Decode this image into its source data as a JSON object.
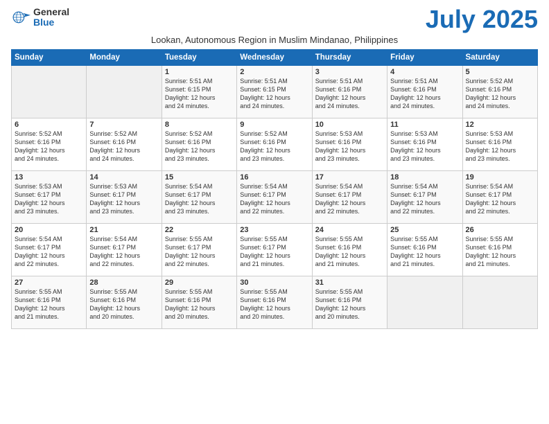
{
  "logo": {
    "general": "General",
    "blue": "Blue"
  },
  "title": "July 2025",
  "subtitle": "Lookan, Autonomous Region in Muslim Mindanao, Philippines",
  "headers": [
    "Sunday",
    "Monday",
    "Tuesday",
    "Wednesday",
    "Thursday",
    "Friday",
    "Saturday"
  ],
  "weeks": [
    [
      {
        "day": "",
        "info": ""
      },
      {
        "day": "",
        "info": ""
      },
      {
        "day": "1",
        "info": "Sunrise: 5:51 AM\nSunset: 6:15 PM\nDaylight: 12 hours\nand 24 minutes."
      },
      {
        "day": "2",
        "info": "Sunrise: 5:51 AM\nSunset: 6:15 PM\nDaylight: 12 hours\nand 24 minutes."
      },
      {
        "day": "3",
        "info": "Sunrise: 5:51 AM\nSunset: 6:16 PM\nDaylight: 12 hours\nand 24 minutes."
      },
      {
        "day": "4",
        "info": "Sunrise: 5:51 AM\nSunset: 6:16 PM\nDaylight: 12 hours\nand 24 minutes."
      },
      {
        "day": "5",
        "info": "Sunrise: 5:52 AM\nSunset: 6:16 PM\nDaylight: 12 hours\nand 24 minutes."
      }
    ],
    [
      {
        "day": "6",
        "info": "Sunrise: 5:52 AM\nSunset: 6:16 PM\nDaylight: 12 hours\nand 24 minutes."
      },
      {
        "day": "7",
        "info": "Sunrise: 5:52 AM\nSunset: 6:16 PM\nDaylight: 12 hours\nand 24 minutes."
      },
      {
        "day": "8",
        "info": "Sunrise: 5:52 AM\nSunset: 6:16 PM\nDaylight: 12 hours\nand 23 minutes."
      },
      {
        "day": "9",
        "info": "Sunrise: 5:52 AM\nSunset: 6:16 PM\nDaylight: 12 hours\nand 23 minutes."
      },
      {
        "day": "10",
        "info": "Sunrise: 5:53 AM\nSunset: 6:16 PM\nDaylight: 12 hours\nand 23 minutes."
      },
      {
        "day": "11",
        "info": "Sunrise: 5:53 AM\nSunset: 6:16 PM\nDaylight: 12 hours\nand 23 minutes."
      },
      {
        "day": "12",
        "info": "Sunrise: 5:53 AM\nSunset: 6:16 PM\nDaylight: 12 hours\nand 23 minutes."
      }
    ],
    [
      {
        "day": "13",
        "info": "Sunrise: 5:53 AM\nSunset: 6:17 PM\nDaylight: 12 hours\nand 23 minutes."
      },
      {
        "day": "14",
        "info": "Sunrise: 5:53 AM\nSunset: 6:17 PM\nDaylight: 12 hours\nand 23 minutes."
      },
      {
        "day": "15",
        "info": "Sunrise: 5:54 AM\nSunset: 6:17 PM\nDaylight: 12 hours\nand 23 minutes."
      },
      {
        "day": "16",
        "info": "Sunrise: 5:54 AM\nSunset: 6:17 PM\nDaylight: 12 hours\nand 22 minutes."
      },
      {
        "day": "17",
        "info": "Sunrise: 5:54 AM\nSunset: 6:17 PM\nDaylight: 12 hours\nand 22 minutes."
      },
      {
        "day": "18",
        "info": "Sunrise: 5:54 AM\nSunset: 6:17 PM\nDaylight: 12 hours\nand 22 minutes."
      },
      {
        "day": "19",
        "info": "Sunrise: 5:54 AM\nSunset: 6:17 PM\nDaylight: 12 hours\nand 22 minutes."
      }
    ],
    [
      {
        "day": "20",
        "info": "Sunrise: 5:54 AM\nSunset: 6:17 PM\nDaylight: 12 hours\nand 22 minutes."
      },
      {
        "day": "21",
        "info": "Sunrise: 5:54 AM\nSunset: 6:17 PM\nDaylight: 12 hours\nand 22 minutes."
      },
      {
        "day": "22",
        "info": "Sunrise: 5:55 AM\nSunset: 6:17 PM\nDaylight: 12 hours\nand 22 minutes."
      },
      {
        "day": "23",
        "info": "Sunrise: 5:55 AM\nSunset: 6:17 PM\nDaylight: 12 hours\nand 21 minutes."
      },
      {
        "day": "24",
        "info": "Sunrise: 5:55 AM\nSunset: 6:16 PM\nDaylight: 12 hours\nand 21 minutes."
      },
      {
        "day": "25",
        "info": "Sunrise: 5:55 AM\nSunset: 6:16 PM\nDaylight: 12 hours\nand 21 minutes."
      },
      {
        "day": "26",
        "info": "Sunrise: 5:55 AM\nSunset: 6:16 PM\nDaylight: 12 hours\nand 21 minutes."
      }
    ],
    [
      {
        "day": "27",
        "info": "Sunrise: 5:55 AM\nSunset: 6:16 PM\nDaylight: 12 hours\nand 21 minutes."
      },
      {
        "day": "28",
        "info": "Sunrise: 5:55 AM\nSunset: 6:16 PM\nDaylight: 12 hours\nand 20 minutes."
      },
      {
        "day": "29",
        "info": "Sunrise: 5:55 AM\nSunset: 6:16 PM\nDaylight: 12 hours\nand 20 minutes."
      },
      {
        "day": "30",
        "info": "Sunrise: 5:55 AM\nSunset: 6:16 PM\nDaylight: 12 hours\nand 20 minutes."
      },
      {
        "day": "31",
        "info": "Sunrise: 5:55 AM\nSunset: 6:16 PM\nDaylight: 12 hours\nand 20 minutes."
      },
      {
        "day": "",
        "info": ""
      },
      {
        "day": "",
        "info": ""
      }
    ]
  ]
}
